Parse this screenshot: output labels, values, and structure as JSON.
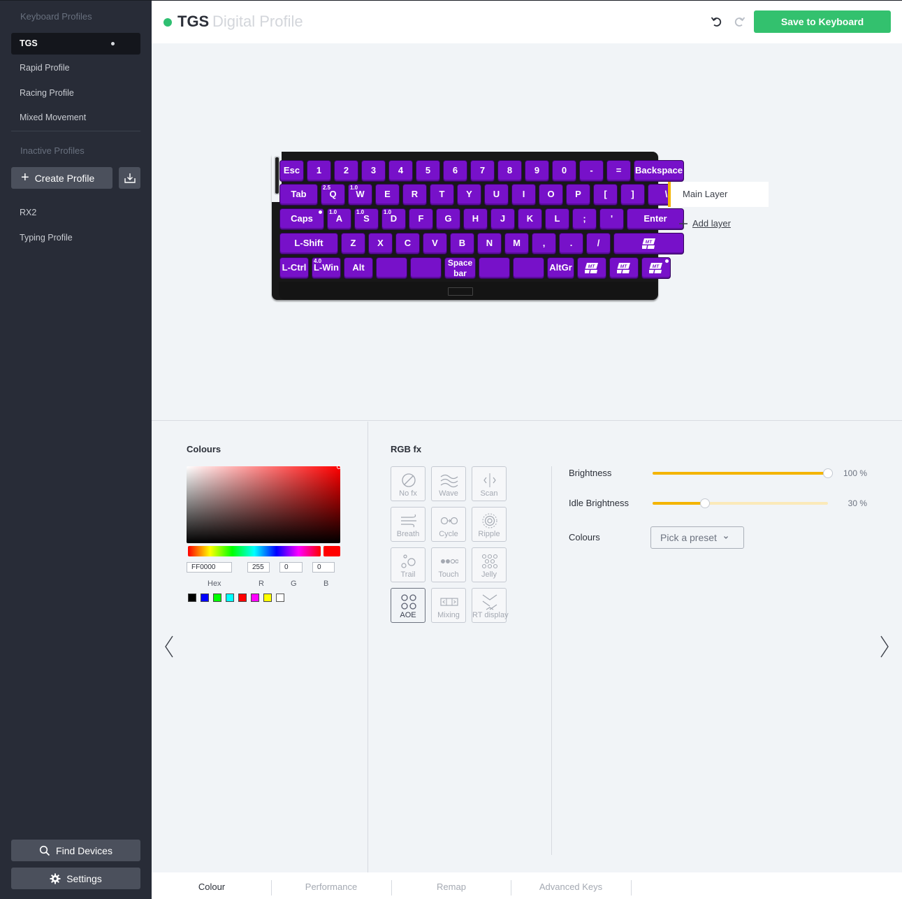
{
  "sidebar": {
    "keyboard_profiles_heading": "Keyboard Profiles",
    "active_profiles": [
      {
        "label": "TGS",
        "active": true
      },
      {
        "label": "Rapid Profile",
        "active": false
      },
      {
        "label": "Racing Profile",
        "active": false
      },
      {
        "label": "Mixed Movement",
        "active": false
      }
    ],
    "inactive_profiles_heading": "Inactive Profiles",
    "create_profile_label": "Create Profile",
    "inactive_profiles": [
      {
        "label": "RX2"
      },
      {
        "label": "Typing Profile"
      }
    ],
    "find_devices_label": "Find Devices",
    "settings_label": "Settings"
  },
  "header": {
    "profile_name": "TGS",
    "profile_type": "Digital Profile",
    "save_label": "Save to Keyboard",
    "status_color": "#2fbf71"
  },
  "keyboard": {
    "key_color": "#7711c9",
    "rows": [
      [
        {
          "label": "Esc"
        },
        {
          "label": "1"
        },
        {
          "label": "2"
        },
        {
          "label": "3"
        },
        {
          "label": "4"
        },
        {
          "label": "5"
        },
        {
          "label": "6"
        },
        {
          "label": "7"
        },
        {
          "label": "8"
        },
        {
          "label": "9"
        },
        {
          "label": "0"
        },
        {
          "label": "-"
        },
        {
          "label": "="
        },
        {
          "label": "Backspace"
        }
      ],
      [
        {
          "label": "Tab"
        },
        {
          "label": "Q",
          "badge": "2.5"
        },
        {
          "label": "W",
          "badge": "1.0"
        },
        {
          "label": "E"
        },
        {
          "label": "R"
        },
        {
          "label": "T"
        },
        {
          "label": "Y"
        },
        {
          "label": "U"
        },
        {
          "label": "I"
        },
        {
          "label": "O"
        },
        {
          "label": "P"
        },
        {
          "label": "["
        },
        {
          "label": "]"
        },
        {
          "label": "\\"
        }
      ],
      [
        {
          "label": "Caps",
          "dot": true
        },
        {
          "label": "A",
          "badge": "1.0"
        },
        {
          "label": "S",
          "badge": "1.0"
        },
        {
          "label": "D",
          "badge": "1.0"
        },
        {
          "label": "F"
        },
        {
          "label": "G"
        },
        {
          "label": "H"
        },
        {
          "label": "J"
        },
        {
          "label": "K"
        },
        {
          "label": "L"
        },
        {
          "label": ";"
        },
        {
          "label": "'"
        },
        {
          "label": "Enter"
        }
      ],
      [
        {
          "label": "L-Shift"
        },
        {
          "label": "Z"
        },
        {
          "label": "X"
        },
        {
          "label": "C"
        },
        {
          "label": "V"
        },
        {
          "label": "B"
        },
        {
          "label": "N"
        },
        {
          "label": "M"
        },
        {
          "label": ","
        },
        {
          "label": "."
        },
        {
          "label": "/"
        },
        {
          "label": "",
          "icon": "mod-tap-icon"
        }
      ],
      [
        {
          "label": "L-Ctrl"
        },
        {
          "label": "L-Win",
          "badge": "4.0"
        },
        {
          "label": "Alt"
        },
        {
          "label": ""
        },
        {
          "label": ""
        },
        {
          "label": "Space bar"
        },
        {
          "label": ""
        },
        {
          "label": ""
        },
        {
          "label": "AltGr"
        },
        {
          "label": "",
          "icon": "mod-tap-icon"
        },
        {
          "label": "",
          "icon": "mod-tap-icon"
        },
        {
          "label": "",
          "icon": "mod-tap-icon",
          "dot": true
        }
      ]
    ]
  },
  "layers": {
    "main_layer_label": "Main Layer",
    "add_layer_label": "Add layer",
    "accent": "#f4b400"
  },
  "colours": {
    "title": "Colours",
    "hex_value": "FF0000",
    "r_value": "255",
    "g_value": "0",
    "b_value": "0",
    "hex_label": "Hex",
    "r_label": "R",
    "g_label": "G",
    "b_label": "B",
    "swatches": [
      "#000000",
      "#0000ff",
      "#00ff00",
      "#00ffff",
      "#ff0000",
      "#ff00ff",
      "#ffff00",
      "#ffffff"
    ]
  },
  "rgb_fx": {
    "title": "RGB fx",
    "effects": [
      {
        "label": "No fx",
        "icon": "no-fx-icon",
        "active": false
      },
      {
        "label": "Wave",
        "icon": "wave-icon",
        "active": false
      },
      {
        "label": "Scan",
        "icon": "scan-icon",
        "active": false
      },
      {
        "label": "Breath",
        "icon": "breath-icon",
        "active": false
      },
      {
        "label": "Cycle",
        "icon": "cycle-icon",
        "active": false
      },
      {
        "label": "Ripple",
        "icon": "ripple-icon",
        "active": false
      },
      {
        "label": "Trail",
        "icon": "trail-icon",
        "active": false
      },
      {
        "label": "Touch",
        "icon": "touch-icon",
        "active": false
      },
      {
        "label": "Jelly",
        "icon": "jelly-icon",
        "active": false
      },
      {
        "label": "AOE",
        "icon": "aoe-icon",
        "active": true
      },
      {
        "label": "Mixing",
        "icon": "mixing-icon",
        "active": false
      },
      {
        "label": "RT display",
        "icon": "rt-display-icon",
        "active": false
      }
    ]
  },
  "lighting": {
    "brightness_label": "Brightness",
    "brightness_value": 100,
    "brightness_text": "100 %",
    "idle_brightness_label": "Idle Brightness",
    "idle_brightness_value": 30,
    "idle_brightness_text": "30 %",
    "colours_label": "Colours",
    "preset_placeholder": "Pick a preset"
  },
  "tabs": [
    {
      "label": "Colour",
      "active": true
    },
    {
      "label": "Performance",
      "active": false
    },
    {
      "label": "Remap",
      "active": false
    },
    {
      "label": "Advanced Keys",
      "active": false
    }
  ]
}
